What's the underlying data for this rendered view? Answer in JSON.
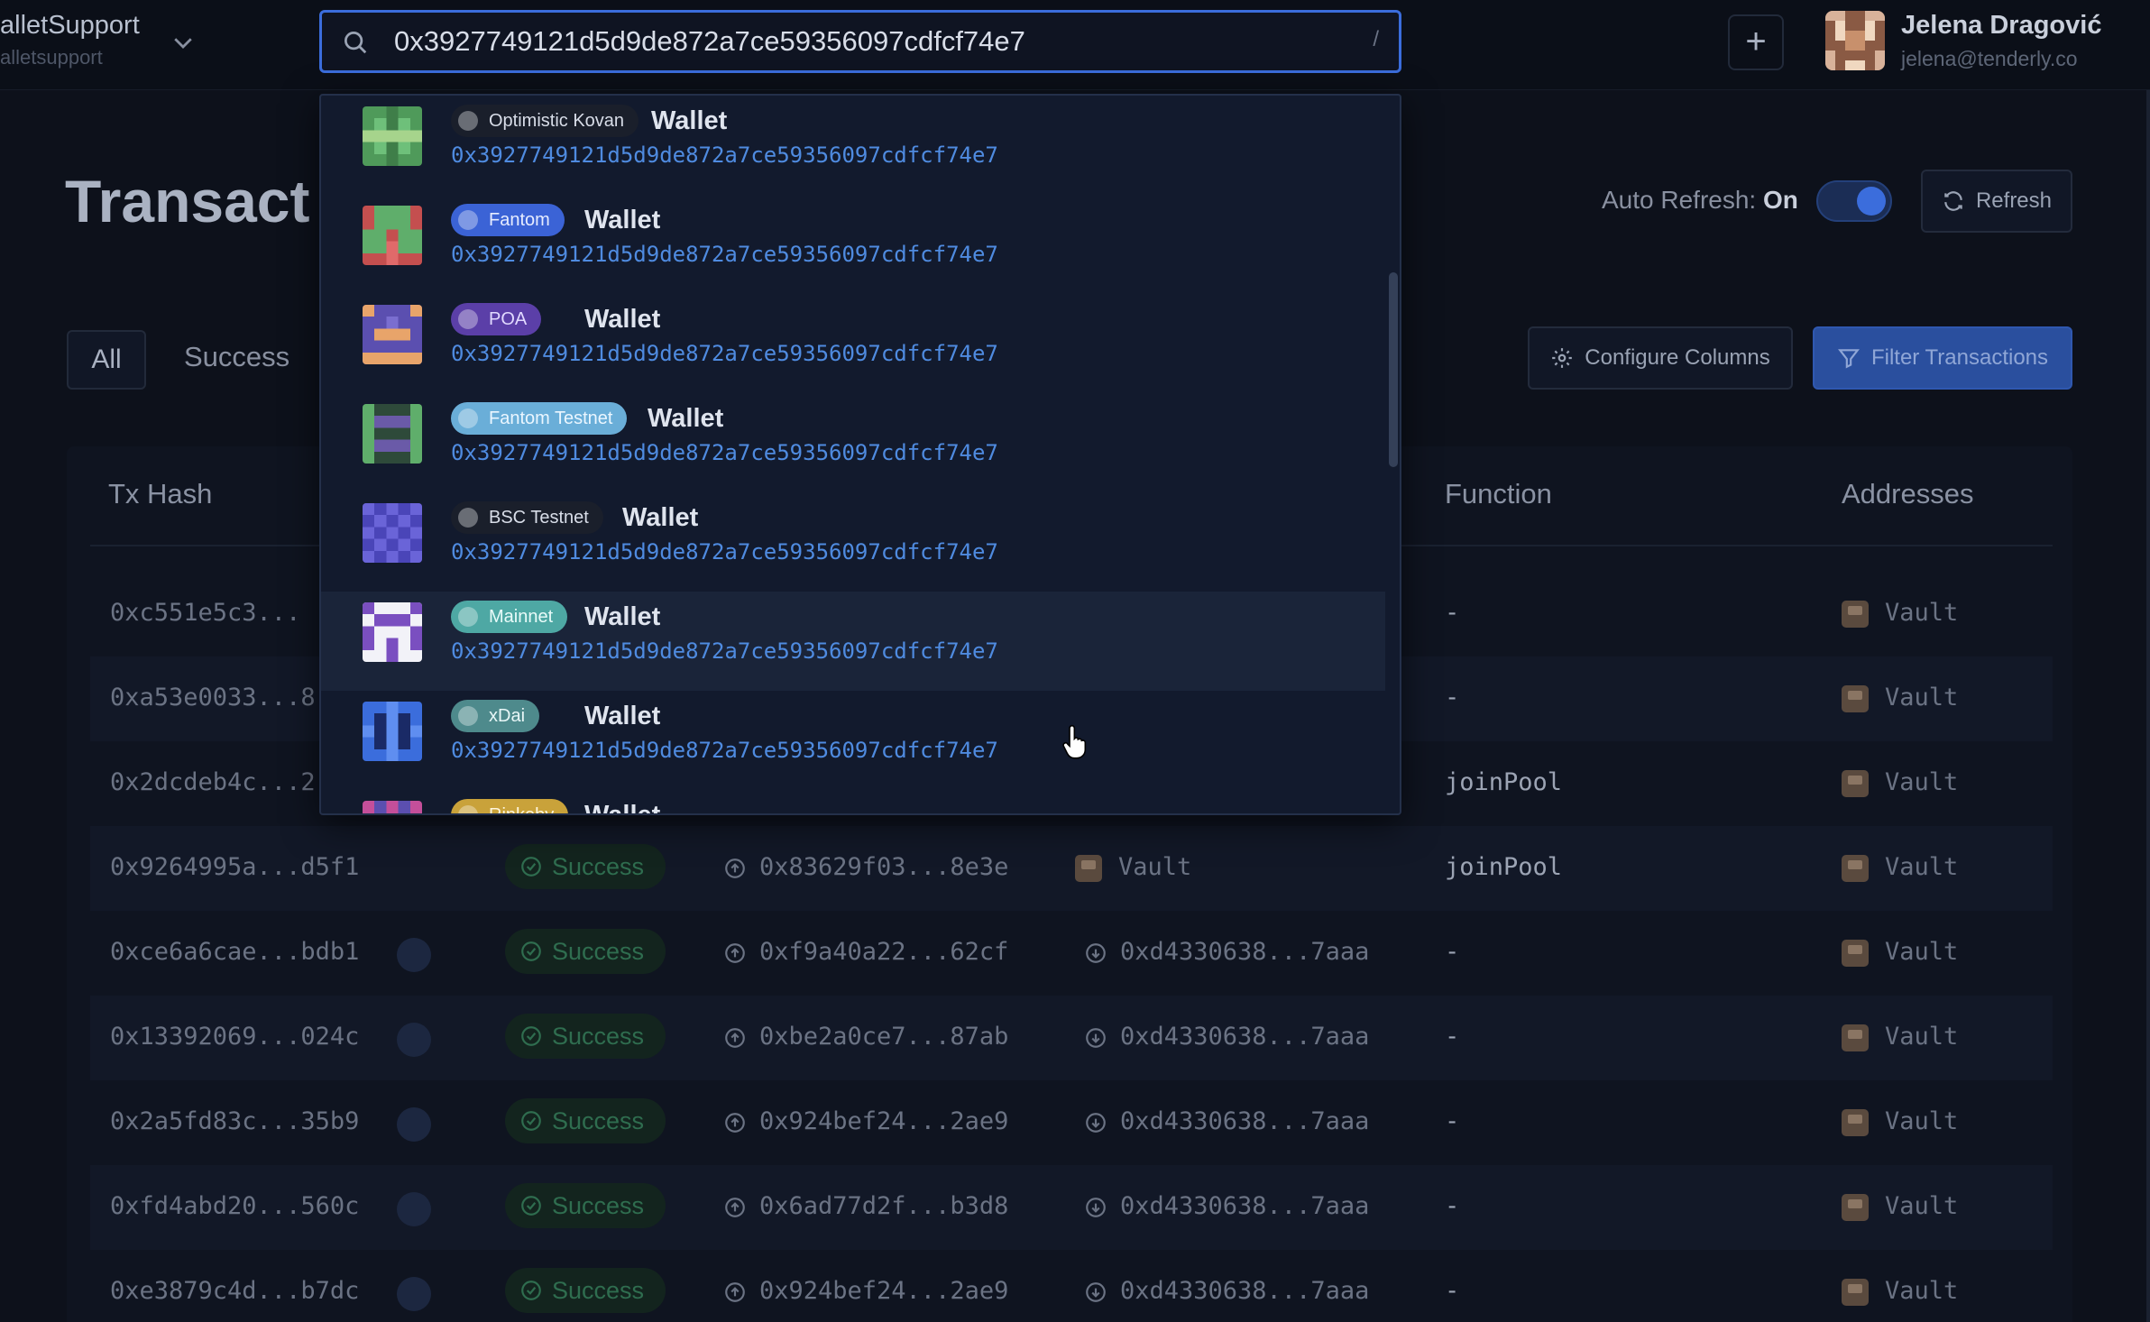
{
  "app": {
    "project_name": "alletSupport",
    "project_slug": "alletsupport"
  },
  "search": {
    "value": "0x3927749121d5d9de872a7ce59356097cdfcf74e7",
    "shortcut": "/"
  },
  "user": {
    "name": "Jelena Dragović",
    "email": "jelena@tenderly.co"
  },
  "page": {
    "title": "Transact"
  },
  "controls": {
    "auto_refresh_label": "Auto Refresh:",
    "auto_refresh_state": "On",
    "refresh_label": "Refresh",
    "configure_label": "Configure Columns",
    "filter_label": "Filter Transactions"
  },
  "tabs": [
    {
      "label": "All"
    },
    {
      "label": "Success"
    }
  ],
  "table": {
    "headers": {
      "tx_hash": "Tx Hash",
      "function": "Function",
      "addresses": "Addresses"
    },
    "rows": [
      {
        "hash": "0xc551e5c3...",
        "status": "",
        "from": "",
        "to": "",
        "function": "-",
        "address": "Vault"
      },
      {
        "hash": "0xa53e0033...8",
        "status": "",
        "from": "",
        "to": "",
        "function": "-",
        "address": "Vault"
      },
      {
        "hash": "0x2dcdeb4c...2",
        "status": "",
        "from": "",
        "to": "",
        "function": "joinPool",
        "address": "Vault"
      },
      {
        "hash": "0x9264995a...d5f1",
        "status": "Success",
        "from": "0x83629f03...8e3e",
        "to": "Vault",
        "function": "joinPool",
        "address": "Vault"
      },
      {
        "hash": "0xce6a6cae...bdb1",
        "status": "Success",
        "from": "0xf9a40a22...62cf",
        "to": "0xd4330638...7aaa",
        "function": "-",
        "address": "Vault"
      },
      {
        "hash": "0x13392069...024c",
        "status": "Success",
        "from": "0xbe2a0ce7...87ab",
        "to": "0xd4330638...7aaa",
        "function": "-",
        "address": "Vault"
      },
      {
        "hash": "0x2a5fd83c...35b9",
        "status": "Success",
        "from": "0x924bef24...2ae9",
        "to": "0xd4330638...7aaa",
        "function": "-",
        "address": "Vault"
      },
      {
        "hash": "0xfd4abd20...560c",
        "status": "Success",
        "from": "0x6ad77d2f...b3d8",
        "to": "0xd4330638...7aaa",
        "function": "-",
        "address": "Vault"
      },
      {
        "hash": "0xe3879c4d...b7dc",
        "status": "Success",
        "from": "0x924bef24...2ae9",
        "to": "0xd4330638...7aaa",
        "function": "-",
        "address": "Vault"
      }
    ]
  },
  "dropdown": {
    "items": [
      {
        "network": "Optimistic Kovan",
        "label": "Wallet",
        "address": "0x3927749121d5d9de872a7ce59356097cdfcf74e7",
        "pill_color": "#1a1f2b",
        "pill_text_color": "#d8dde8"
      },
      {
        "network": "Fantom",
        "label": "Wallet",
        "address": "0x3927749121d5d9de872a7ce59356097cdfcf74e7",
        "pill_color": "#3b63d6",
        "pill_text_color": "#e6ecff"
      },
      {
        "network": "POA",
        "label": "Wallet",
        "address": "0x3927749121d5d9de872a7ce59356097cdfcf74e7",
        "pill_color": "#5b3fa8",
        "pill_text_color": "#e1d9ff"
      },
      {
        "network": "Fantom Testnet",
        "label": "Wallet",
        "address": "0x3927749121d5d9de872a7ce59356097cdfcf74e7",
        "pill_color": "#6aaed8",
        "pill_text_color": "#eaf6ff"
      },
      {
        "network": "BSC Testnet",
        "label": "Wallet",
        "address": "0x3927749121d5d9de872a7ce59356097cdfcf74e7",
        "pill_color": "#1a1f2b",
        "pill_text_color": "#d8dde8"
      },
      {
        "network": "Mainnet",
        "label": "Wallet",
        "address": "0x3927749121d5d9de872a7ce59356097cdfcf74e7",
        "pill_color": "#4ea8a4",
        "pill_text_color": "#e8fbf9"
      },
      {
        "network": "xDai",
        "label": "Wallet",
        "address": "0x3927749121d5d9de872a7ce59356097cdfcf74e7",
        "pill_color": "#4e8a8c",
        "pill_text_color": "#e8f7f7"
      },
      {
        "network": "Rinkeby",
        "label": "Wallet",
        "address": "",
        "pill_color": "#c9a23a",
        "pill_text_color": "#fff6dc"
      }
    ]
  },
  "colors": {
    "accent": "#3b6ddc",
    "address_link": "#4f8be0",
    "success_text": "#2f6d4f"
  }
}
